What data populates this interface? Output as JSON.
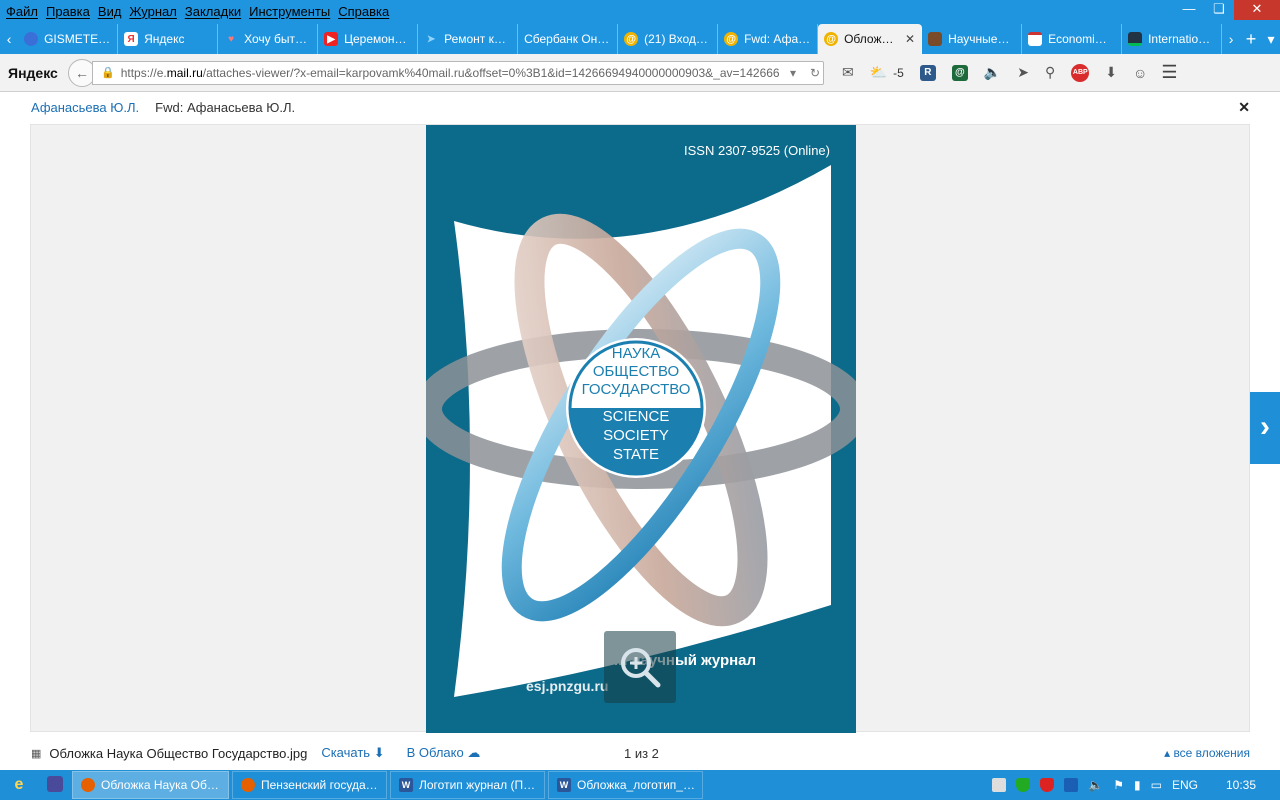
{
  "menubar": {
    "items": [
      "Файл",
      "Правка",
      "Вид",
      "Журнал",
      "Закладки",
      "Инструменты",
      "Справка"
    ]
  },
  "tabs": [
    {
      "label": "GISMETE…",
      "icon": "globe-icon",
      "color": "#3b6fd8"
    },
    {
      "label": "Яндекс",
      "icon": "yandex-icon",
      "color": "#e33"
    },
    {
      "label": "Хочу быт…",
      "icon": "heart-icon",
      "color": "#e66"
    },
    {
      "label": "Церемон…",
      "icon": "youtube-icon",
      "color": "#e22"
    },
    {
      "label": "Ремонт к…",
      "icon": "arrow-icon",
      "color": "#1a8fd9"
    },
    {
      "label": "Сбербанк Он…",
      "icon": "",
      "color": ""
    },
    {
      "label": "(21) Входя…",
      "icon": "mail-at-icon",
      "color": "#f0b400"
    },
    {
      "label": "Fwd: Афа…",
      "icon": "mail-at-icon",
      "color": "#f0b400"
    },
    {
      "label": "Облож…",
      "icon": "mail-at-icon",
      "color": "#f0b400",
      "active": true
    },
    {
      "label": "Научные…",
      "icon": "book-icon",
      "color": "#7a4b2a"
    },
    {
      "label": "Economi…",
      "icon": "page-icon",
      "color": "#c33"
    },
    {
      "label": "Internatio…",
      "icon": "page-icon",
      "color": "#0b5"
    }
  ],
  "navbar": {
    "brand": "Яндекс",
    "url_prefix": "https://e.",
    "url_domain": "mail.ru",
    "url_rest": "/attaches-viewer/?x-email=karpovamk%40mail.ru&offset=0%3B1&id=14266694940000000903&_av=1426669",
    "weather": "-5"
  },
  "viewer": {
    "sender": "Афанасьева Ю.Л.",
    "subject": "Fwd: Афанасьева Ю.Л."
  },
  "cover": {
    "issn": "ISSN  2307-9525 (Online)",
    "logo_ru": [
      "НАУКА",
      "ОБЩЕСТВО",
      "ГОСУДАРСТВО"
    ],
    "logo_en": [
      "SCIENCE",
      "SOCIETY",
      "STATE"
    ],
    "footer_line1": "Электронный научный журнал",
    "footer_line2": "esj.pnzgu.ru",
    "colors": {
      "background": "#0c6a8a",
      "logo_blue": "#1b7fb0"
    }
  },
  "attachment": {
    "filename": "Обложка Наука Общество Государство.jpg",
    "download": "Скачать",
    "cloud": "В Облако",
    "counter": "1 из 2",
    "all": "все вложения"
  },
  "taskbar": {
    "tasks": [
      {
        "label": "Обложка Наука Об…",
        "icon": "firefox-icon",
        "active": true
      },
      {
        "label": "Пензенский госуда…",
        "icon": "firefox-icon"
      },
      {
        "label": "Логотип журнал (П…",
        "icon": "word-icon"
      },
      {
        "label": "Обложка_логотип_…",
        "icon": "word-icon"
      }
    ],
    "language": "ENG",
    "time": "10:35"
  }
}
